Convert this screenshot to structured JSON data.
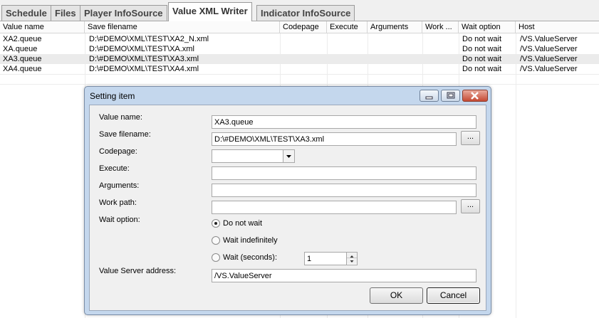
{
  "tabs": [
    {
      "label": "Schedule"
    },
    {
      "label": "Files"
    },
    {
      "label": "Player InfoSource"
    },
    {
      "label": "Value XML Writer"
    },
    {
      "label": "Indicator InfoSource"
    }
  ],
  "grid": {
    "columns": [
      "Value name",
      "Save filename",
      "Codepage",
      "Execute",
      "Arguments",
      "Work ...",
      "Wait option",
      "Host"
    ],
    "rows": [
      {
        "value_name": "XA2.queue",
        "save_filename": "D:\\#DEMO\\XML\\TEST\\XA2_N.xml",
        "codepage": "",
        "execute": "",
        "arguments": "",
        "work": "",
        "wait_option": "Do not wait",
        "host": "/VS.ValueServer"
      },
      {
        "value_name": "XA.queue",
        "save_filename": "D:\\#DEMO\\XML\\TEST\\XA.xml",
        "codepage": "",
        "execute": "",
        "arguments": "",
        "work": "",
        "wait_option": "Do not wait",
        "host": "/VS.ValueServer"
      },
      {
        "value_name": "XA3.queue",
        "save_filename": "D:\\#DEMO\\XML\\TEST\\XA3.xml",
        "codepage": "",
        "execute": "",
        "arguments": "",
        "work": "",
        "wait_option": "Do not wait",
        "host": "/VS.ValueServer"
      },
      {
        "value_name": "XA4.queue",
        "save_filename": "D:\\#DEMO\\XML\\TEST\\XA4.xml",
        "codepage": "",
        "execute": "",
        "arguments": "",
        "work": "",
        "wait_option": "Do not wait",
        "host": "/VS.ValueServer"
      }
    ]
  },
  "dialog": {
    "title": "Setting item",
    "labels": {
      "value_name": "Value name:",
      "save_filename": "Save filename:",
      "codepage": "Codepage:",
      "execute": "Execute:",
      "arguments": "Arguments:",
      "work_path": "Work path:",
      "wait_option": "Wait option:",
      "server_address": "Value Server address:"
    },
    "values": {
      "value_name": "XA3.queue",
      "save_filename": "D:\\#DEMO\\XML\\TEST\\XA3.xml",
      "codepage": "",
      "execute": "",
      "arguments": "",
      "work_path": "",
      "wait_seconds": "1",
      "server_address": "/VS.ValueServer"
    },
    "browse_label": "...",
    "wait_options": [
      {
        "label": "Do not wait",
        "selected": true
      },
      {
        "label": "Wait indefinitely",
        "selected": false
      },
      {
        "label": "Wait (seconds):",
        "selected": false
      }
    ],
    "ok_label": "OK",
    "cancel_label": "Cancel"
  }
}
